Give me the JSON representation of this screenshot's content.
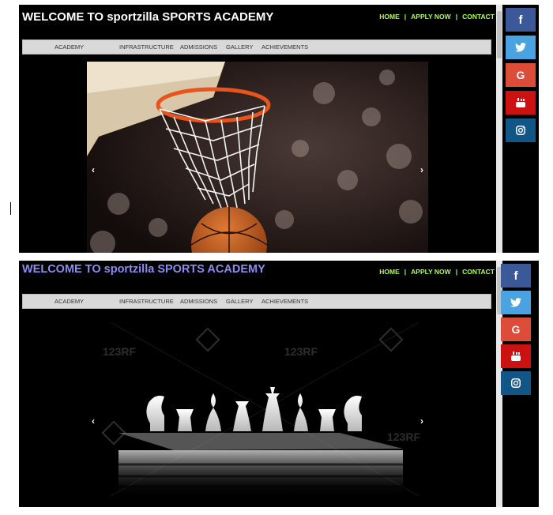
{
  "site": {
    "title": "WELCOME TO sportzilla SPORTS ACADEMY",
    "top_nav": [
      "HOME",
      "APPLY NOW",
      "CONTACT"
    ],
    "top_nav_separator": "|",
    "menu": [
      "ACADEMY",
      "INFRASTRUCTURE",
      "ADMISSIONS",
      "GALLERY",
      "ACHIEVEMENTS"
    ],
    "slider": {
      "prev": "‹",
      "next": "›"
    },
    "social": [
      {
        "name": "facebook-icon",
        "glyph": "f",
        "color": "#3b5998"
      },
      {
        "name": "twitter-icon",
        "glyph": "",
        "color": "#4aa3e0"
      },
      {
        "name": "google-plus-icon",
        "glyph": "G",
        "color": "#dd4b39"
      },
      {
        "name": "youtube-icon",
        "glyph": "",
        "color": "#cc1111"
      },
      {
        "name": "instagram-icon",
        "glyph": "",
        "color": "#125688"
      }
    ]
  },
  "screens": [
    {
      "slide_image": "basketball-hoop-image"
    },
    {
      "slide_image": "chess-pieces-image",
      "watermark": "123RF"
    }
  ],
  "colors": {
    "nav_link": "#aaff55",
    "title_screen2": "#8c8cf2",
    "menubar": "#d9d9d9"
  }
}
